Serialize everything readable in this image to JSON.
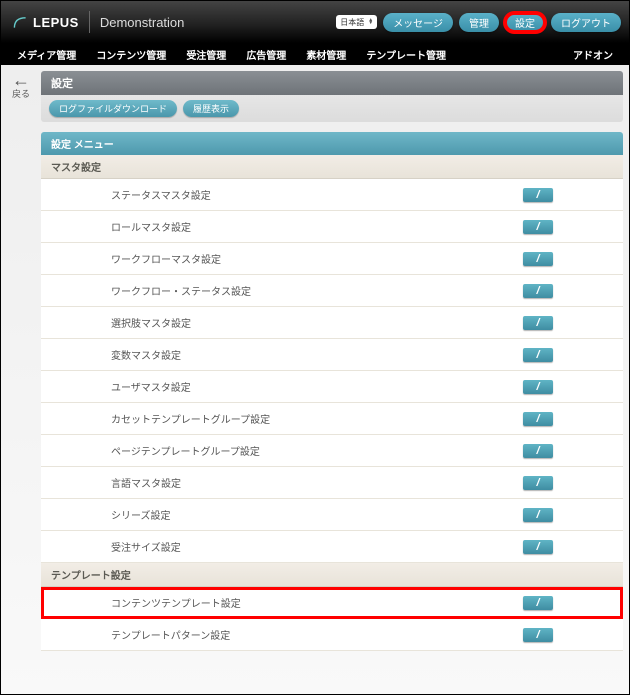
{
  "header": {
    "logo_text": "LEPUS",
    "subtitle": "Demonstration",
    "lang_label": "日本語",
    "buttons": {
      "message": "メッセージ",
      "manage": "管理",
      "settings": "設定",
      "logout": "ログアウト"
    }
  },
  "subnav": [
    "メディア管理",
    "コンテンツ管理",
    "受注管理",
    "広告管理",
    "素材管理",
    "テンプレート管理",
    "アドオン"
  ],
  "back_label": "戻る",
  "page_title": "設定",
  "sub_buttons": {
    "download": "ログファイルダウンロード",
    "history": "履歴表示"
  },
  "section_title": "設定 メニュー",
  "groups": [
    {
      "title": "マスタ設定",
      "items": [
        "ステータスマスタ設定",
        "ロールマスタ設定",
        "ワークフローマスタ設定",
        "ワークフロー・ステータス設定",
        "選択肢マスタ設定",
        "変数マスタ設定",
        "ユーザマスタ設定",
        "カセットテンプレートグループ設定",
        "ページテンプレートグループ設定",
        "言語マスタ設定",
        "シリーズ設定",
        "受注サイズ設定"
      ]
    },
    {
      "title": "テンプレート設定",
      "items": [
        "コンテンツテンプレート設定",
        "テンプレートパターン設定"
      ]
    }
  ]
}
